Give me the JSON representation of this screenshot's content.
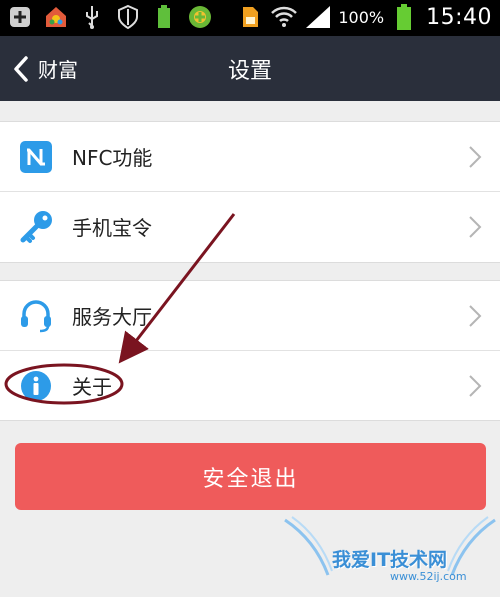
{
  "status_bar": {
    "battery_percent": "100%",
    "time": "15:40",
    "icons": [
      "add-icon",
      "app-store-icon",
      "usb-icon",
      "shield-icon",
      "battery-small-icon",
      "security-app-icon",
      "sim-icon",
      "wifi-icon",
      "signal-icon",
      "battery-icon"
    ]
  },
  "header": {
    "back_label": "财富",
    "title": "设置"
  },
  "settings": {
    "group1": [
      {
        "label": "NFC功能",
        "icon": "nfc-icon"
      },
      {
        "label": "手机宝令",
        "icon": "key-icon"
      }
    ],
    "group2": [
      {
        "label": "服务大厅",
        "icon": "headset-icon"
      },
      {
        "label": "关于",
        "icon": "info-icon"
      }
    ]
  },
  "logout_label": "安全退出",
  "watermark": {
    "text": "我爱IT技术网",
    "url": "www.52ij.com"
  },
  "colors": {
    "status_bar": "#000000",
    "title_bar": "#2a2f3b",
    "background": "#eeeeee",
    "accent_blue": "#2d9be8",
    "logout_red": "#ef5b5b",
    "annotation": "#7a1420"
  }
}
